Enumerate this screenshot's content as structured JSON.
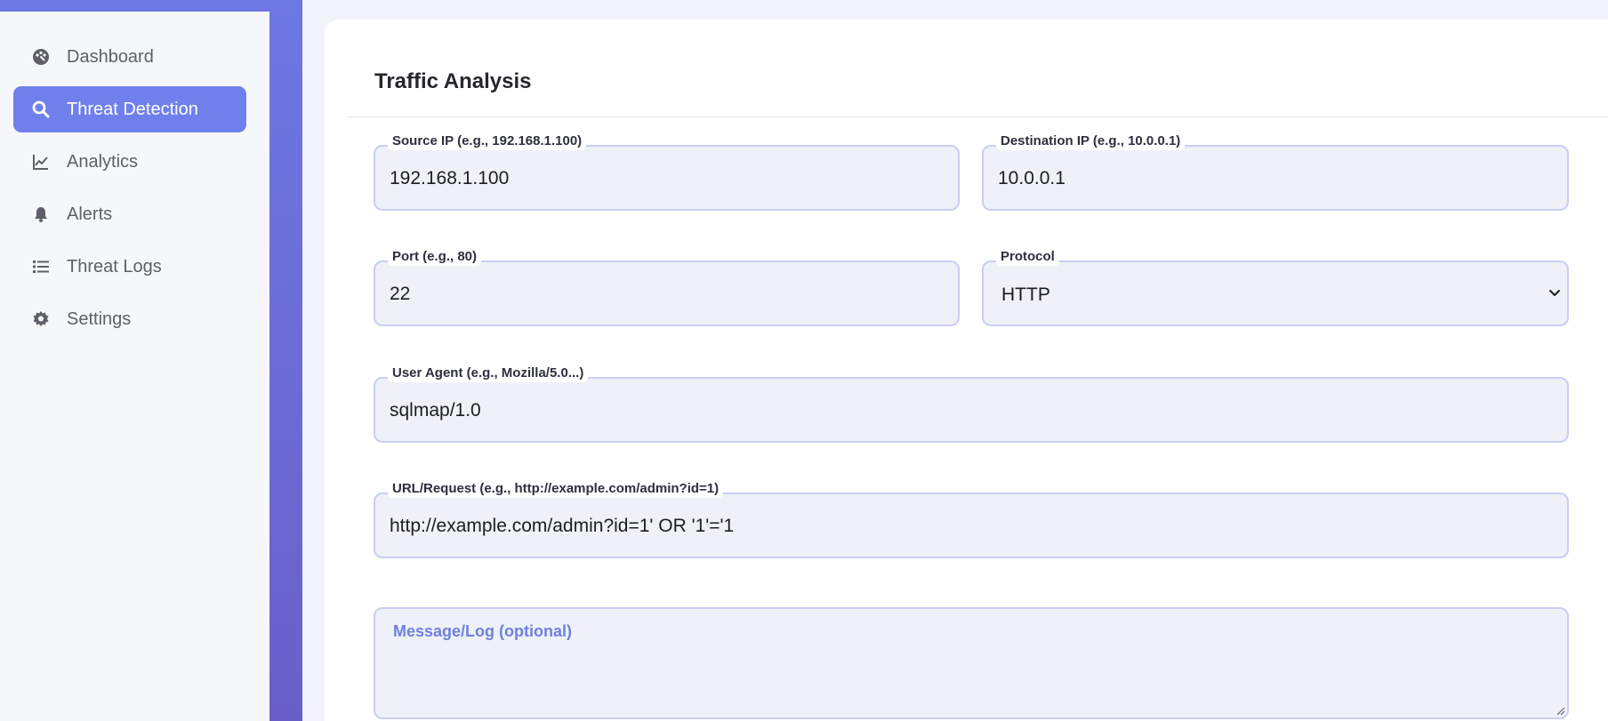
{
  "sidebar": {
    "items": [
      {
        "label": "Dashboard",
        "icon": "palette-icon",
        "active": false
      },
      {
        "label": "Threat Detection",
        "icon": "search-icon",
        "active": true
      },
      {
        "label": "Analytics",
        "icon": "line-chart-icon",
        "active": false
      },
      {
        "label": "Alerts",
        "icon": "bell-icon",
        "active": false
      },
      {
        "label": "Threat Logs",
        "icon": "list-icon",
        "active": false
      },
      {
        "label": "Settings",
        "icon": "gear-icon",
        "active": false
      }
    ]
  },
  "main": {
    "title": "Traffic Analysis",
    "fields": {
      "source_ip": {
        "label": "Source IP (e.g., 192.168.1.100)",
        "value": "192.168.1.100"
      },
      "destination_ip": {
        "label": "Destination IP (e.g., 10.0.0.1)",
        "value": "10.0.0.1"
      },
      "port": {
        "label": "Port (e.g., 80)",
        "value": "22"
      },
      "protocol": {
        "label": "Protocol",
        "value": "HTTP"
      },
      "user_agent": {
        "label": "User Agent (e.g., Mozilla/5.0...)",
        "value": "sqlmap/1.0"
      },
      "url": {
        "label": "URL/Request (e.g., http://example.com/admin?id=1)",
        "value": "http://example.com/admin?id=1' OR '1'='1"
      },
      "message": {
        "placeholder": "Message/Log (optional)"
      }
    }
  },
  "colors": {
    "accent": "#6f80ec",
    "sidebar_bg": "#f6f7fb",
    "gradient_start": "#6d78e3",
    "gradient_end": "#6a5fc9",
    "field_bg": "#eff1f8",
    "field_border": "#c8cff0"
  }
}
